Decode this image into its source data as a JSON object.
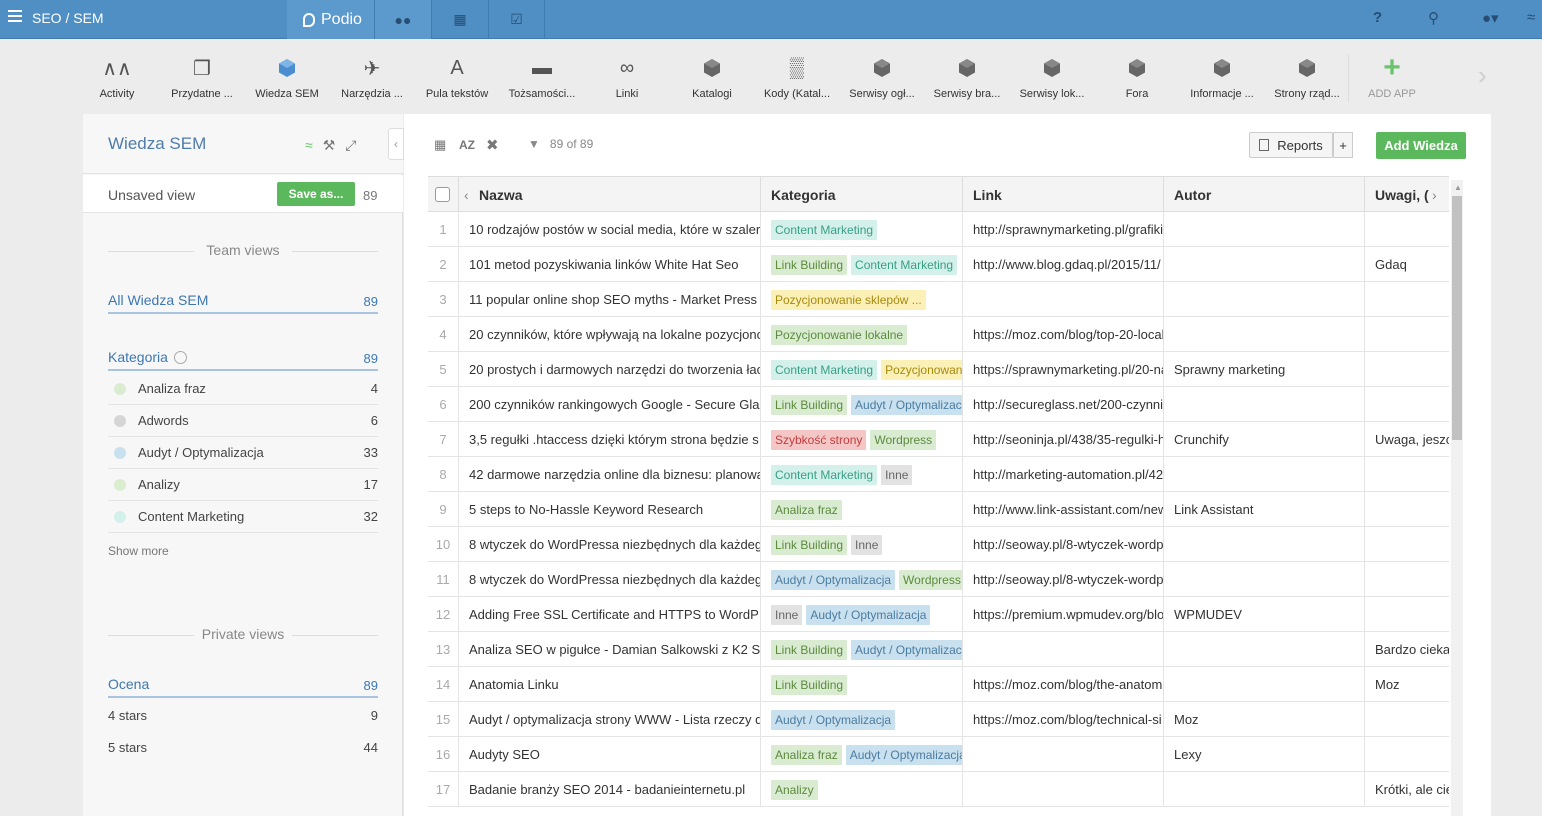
{
  "topbar": {
    "workspace": "SEO / SEM",
    "brand": "Podio",
    "help": "?"
  },
  "apps": [
    {
      "label": "Activity",
      "icon": "activity-icon",
      "glyph": "∧∧"
    },
    {
      "label": "Przydatne ...",
      "icon": "document-icon",
      "glyph": "❐"
    },
    {
      "label": "Wiedza SEM",
      "icon": "cube-icon",
      "glyph": "",
      "active": true
    },
    {
      "label": "Narzędzia ...",
      "icon": "rocket-icon",
      "glyph": "✈"
    },
    {
      "label": "Pula tekstów",
      "icon": "letter-a-icon",
      "glyph": "A"
    },
    {
      "label": "Tożsamości...",
      "icon": "hat-icon",
      "glyph": "▬"
    },
    {
      "label": "Linki",
      "icon": "link-icon",
      "glyph": "∞"
    },
    {
      "label": "Katalogi",
      "icon": "cube-icon",
      "glyph": ""
    },
    {
      "label": "Kody (Katal...",
      "icon": "barcode-icon",
      "glyph": "▒"
    },
    {
      "label": "Serwisy ogł...",
      "icon": "cube-icon",
      "glyph": ""
    },
    {
      "label": "Serwisy bra...",
      "icon": "cube-icon",
      "glyph": ""
    },
    {
      "label": "Serwisy lok...",
      "icon": "cube-icon",
      "glyph": ""
    },
    {
      "label": "Fora",
      "icon": "cube-icon",
      "glyph": ""
    },
    {
      "label": "Informacje ...",
      "icon": "cube-icon",
      "glyph": ""
    },
    {
      "label": "Strony rząd...",
      "icon": "cube-icon",
      "glyph": ""
    },
    {
      "label": "ADD APP",
      "icon": "plus-icon",
      "glyph": "+"
    }
  ],
  "sidebar": {
    "title": "Wiedza SEM",
    "unsaved_label": "Unsaved view",
    "save_label": "Save as...",
    "unsaved_count": "89",
    "team_views_title": "Team views",
    "all_view": {
      "label": "All Wiedza SEM",
      "count": "89"
    },
    "category": {
      "label": "Kategoria",
      "count": "89"
    },
    "categories": [
      {
        "label": "Analiza fraz",
        "count": "4",
        "color": "#d9ecd1"
      },
      {
        "label": "Adwords",
        "count": "6",
        "color": "#d5d5d5"
      },
      {
        "label": "Audyt / Optymalizacja",
        "count": "33",
        "color": "#c9e0ef"
      },
      {
        "label": "Analizy",
        "count": "17",
        "color": "#dbedcf"
      },
      {
        "label": "Content Marketing",
        "count": "32",
        "color": "#d3f1ea"
      }
    ],
    "show_more": "Show more",
    "private_views_title": "Private views",
    "rating": {
      "label": "Ocena",
      "count": "89"
    },
    "ratings": [
      {
        "label": "4 stars",
        "count": "9"
      },
      {
        "label": "5 stars",
        "count": "44"
      }
    ]
  },
  "toolbar": {
    "sort_label": "AZ",
    "filter_count": "89 of 89",
    "reports_label": "Reports",
    "plus_label": "+",
    "add_label": "Add Wiedza"
  },
  "table": {
    "columns": [
      "Nazwa",
      "Kategoria",
      "Link",
      "Autor",
      "Uwagi, ("
    ],
    "tag_colors": {
      "Content Marketing": "#d3f1ea",
      "Link Building": "#d9ecd1",
      "Pozycjonowanie sklepów ...": "#fbf0b5",
      "Pozycjonowanie lokalne": "#d9ecd1",
      "Pozycjonowan": "#fbf0b5",
      "Audyt / Optymalizac": "#c9e0ef",
      "Audyt / Optymalizacja": "#c9e0ef",
      "Szybkość strony": "#f5c6c6",
      "Wordpress": "#d9ecd1",
      "Inne": "#e2e2e2",
      "Analiza fraz": "#d9ecd1",
      "Analizy": "#d9ecd1"
    },
    "tag_text_colors": {
      "Content Marketing": "#3a9e88",
      "Link Building": "#5c8a3e",
      "Pozycjonowanie sklepów ...": "#a88a10",
      "Pozycjonowanie lokalne": "#5c8a3e",
      "Pozycjonowan": "#a88a10",
      "Audyt / Optymalizac": "#4a7ca0",
      "Audyt / Optymalizacja": "#4a7ca0",
      "Szybkość strony": "#c43d3d",
      "Wordpress": "#5c8a3e",
      "Inne": "#666666",
      "Analiza fraz": "#5c8a3e",
      "Analizy": "#5c8a3e"
    },
    "rows": [
      {
        "n": "1",
        "name": "10 rodzajów postów w social media, które w szaler",
        "tags": [
          "Content Marketing"
        ],
        "link": "http://sprawnymarketing.pl/grafiki",
        "author": "",
        "notes": ""
      },
      {
        "n": "2",
        "name": "101 metod pozyskiwania linków White Hat Seo",
        "tags": [
          "Link Building",
          "Content Marketing"
        ],
        "link": "http://www.blog.gdaq.pl/2015/11/",
        "author": "",
        "notes": "Gdaq"
      },
      {
        "n": "3",
        "name": "11 popular online shop SEO myths - Market Press",
        "tags": [
          "Pozycjonowanie sklepów ..."
        ],
        "link": "",
        "author": "",
        "notes": ""
      },
      {
        "n": "4",
        "name": "20 czynników, które wpływają na lokalne pozycjono",
        "tags": [
          "Pozycjonowanie lokalne"
        ],
        "link": "https://moz.com/blog/top-20-local",
        "author": "",
        "notes": ""
      },
      {
        "n": "5",
        "name": "20 prostych i darmowych narzędzi do tworzenia łac",
        "tags": [
          "Content Marketing",
          "Pozycjonowan"
        ],
        "link": "https://sprawnymarketing.pl/20-na",
        "author": "Sprawny marketing",
        "notes": ""
      },
      {
        "n": "6",
        "name": "200 czynników rankingowych Google - Secure Gla",
        "tags": [
          "Link Building",
          "Audyt / Optymalizac"
        ],
        "link": "http://secureglass.net/200-czynni",
        "author": "",
        "notes": ""
      },
      {
        "n": "7",
        "name": "3,5 regułki .htaccess dzięki którym strona będzie s",
        "tags": [
          "Szybkość strony",
          "Wordpress"
        ],
        "link": "http://seoninja.pl/438/35-regulki-h",
        "author": "Crunchify",
        "notes": "Uwaga, jeszc"
      },
      {
        "n": "8",
        "name": "42 darmowe narzędzia online dla biznesu: planowa",
        "tags": [
          "Content Marketing",
          "Inne"
        ],
        "link": "http://marketing-automation.pl/42",
        "author": "",
        "notes": ""
      },
      {
        "n": "9",
        "name": "5 steps to No-Hassle Keyword Research",
        "tags": [
          "Analiza fraz"
        ],
        "link": "http://www.link-assistant.com/new",
        "author": "Link Assistant",
        "notes": ""
      },
      {
        "n": "10",
        "name": "8 wtyczek do WordPressa niezbędnych dla każdeg",
        "tags": [
          "Link Building",
          "Inne"
        ],
        "link": "http://seoway.pl/8-wtyczek-wordp",
        "author": "",
        "notes": ""
      },
      {
        "n": "11",
        "name": "8 wtyczek do WordPressa niezbędnych dla każdeg",
        "tags": [
          "Audyt / Optymalizacja",
          "Wordpress"
        ],
        "link": "http://seoway.pl/8-wtyczek-wordp",
        "author": "",
        "notes": ""
      },
      {
        "n": "12",
        "name": "Adding Free SSL Certificate and HTTPS to WordP",
        "tags": [
          "Inne",
          "Audyt / Optymalizacja"
        ],
        "link": "https://premium.wpmudev.org/blo",
        "author": "WPMUDEV",
        "notes": ""
      },
      {
        "n": "13",
        "name": "Analiza SEO w pigułce - Damian Salkowski z K2 S",
        "tags": [
          "Link Building",
          "Audyt / Optymalizac"
        ],
        "link": "",
        "author": "",
        "notes": "Bardzo cieka"
      },
      {
        "n": "14",
        "name": "Anatomia Linku",
        "tags": [
          "Link Building"
        ],
        "link": "https://moz.com/blog/the-anatom",
        "author": "",
        "notes": "Moz"
      },
      {
        "n": "15",
        "name": "Audyt / optymalizacja strony WWW - Lista rzeczy d",
        "tags": [
          "Audyt / Optymalizacja"
        ],
        "link": "https://moz.com/blog/technical-si",
        "author": "Moz",
        "notes": ""
      },
      {
        "n": "16",
        "name": "Audyty SEO",
        "tags": [
          "Analiza fraz",
          "Audyt / Optymalizacja"
        ],
        "link": "",
        "author": "Lexy",
        "notes": ""
      },
      {
        "n": "17",
        "name": "Badanie branży SEO 2014 - badanieinternetu.pl",
        "tags": [
          "Analizy"
        ],
        "link": "",
        "author": "",
        "notes": "Krótki, ale cie"
      }
    ]
  }
}
